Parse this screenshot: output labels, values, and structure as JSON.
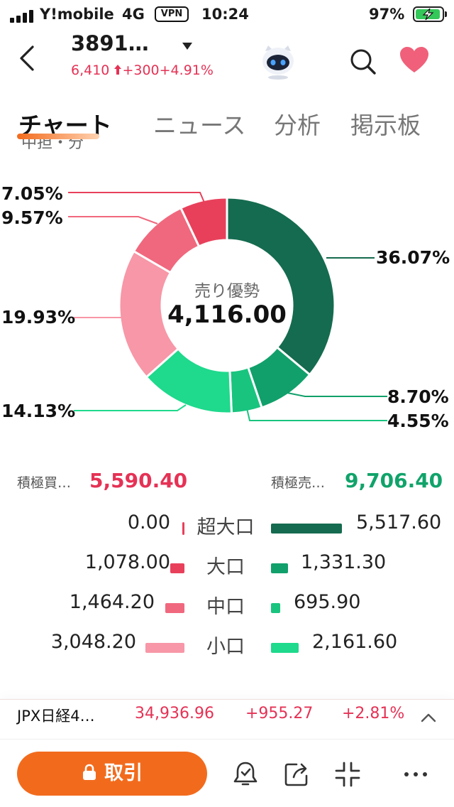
{
  "status_bar": {
    "carrier": "Y!mobile",
    "network": "4G",
    "vpn": "VPN",
    "time": "10:24",
    "battery": "97%"
  },
  "header": {
    "ticker": "3891…",
    "price": "6,410",
    "change": "+300",
    "change_pct": "+4.91%",
    "up_color": "#e53255"
  },
  "tabs": [
    {
      "label": "チャート",
      "active": true
    },
    {
      "label": "ニュース",
      "active": false
    },
    {
      "label": "分析",
      "active": false
    },
    {
      "label": "掲示板",
      "active": false
    }
  ],
  "section_cut_text": "中担・分",
  "chart_data": {
    "type": "pie",
    "style": "donut",
    "center_label": "売り優勢",
    "center_value": "4,116.00",
    "slices": [
      {
        "label": "36.07%",
        "value": 36.07,
        "color": "#156b4f"
      },
      {
        "label": "8.70%",
        "value": 8.7,
        "color": "#11a06b"
      },
      {
        "label": "4.55%",
        "value": 4.55,
        "color": "#19c47f"
      },
      {
        "label": "14.13%",
        "value": 14.13,
        "color": "#1fd98c"
      },
      {
        "label": "19.93%",
        "value": 19.93,
        "color": "#f797a7"
      },
      {
        "label": "9.57%",
        "value": 9.57,
        "color": "#f0687d"
      },
      {
        "label": "7.05%",
        "value": 7.05,
        "color": "#e8405b"
      }
    ]
  },
  "summary": {
    "buy_label": "積極買…",
    "buy_value": "5,590.40",
    "buy_color": "#e53255",
    "sell_label": "積極売…",
    "sell_value": "9,706.40",
    "sell_color": "#10a36a"
  },
  "breakdown": [
    {
      "category": "超大口",
      "buy": "0.00",
      "sell": "5,517.60",
      "buy_num": 0.0,
      "sell_num": 5517.6,
      "buy_color": "#e8405b",
      "sell_color": "#156b4f"
    },
    {
      "category": "大口",
      "buy": "1,078.00",
      "sell": "1,331.30",
      "buy_num": 1078.0,
      "sell_num": 1331.3,
      "buy_color": "#e8405b",
      "sell_color": "#11a06b"
    },
    {
      "category": "中口",
      "buy": "1,464.20",
      "sell": "695.90",
      "buy_num": 1464.2,
      "sell_num": 695.9,
      "buy_color": "#f0687d",
      "sell_color": "#19c47f"
    },
    {
      "category": "小口",
      "buy": "3,048.20",
      "sell": "2,161.60",
      "buy_num": 3048.2,
      "sell_num": 2161.6,
      "buy_color": "#f797a7",
      "sell_color": "#1fd98c"
    }
  ],
  "index_bar": {
    "name": "JPX日経4…",
    "value": "34,936.96",
    "change": "+955.27",
    "change_pct": "+2.81%"
  },
  "action_bar": {
    "trade_label": "取引",
    "trade_color": "#f26b1d"
  }
}
